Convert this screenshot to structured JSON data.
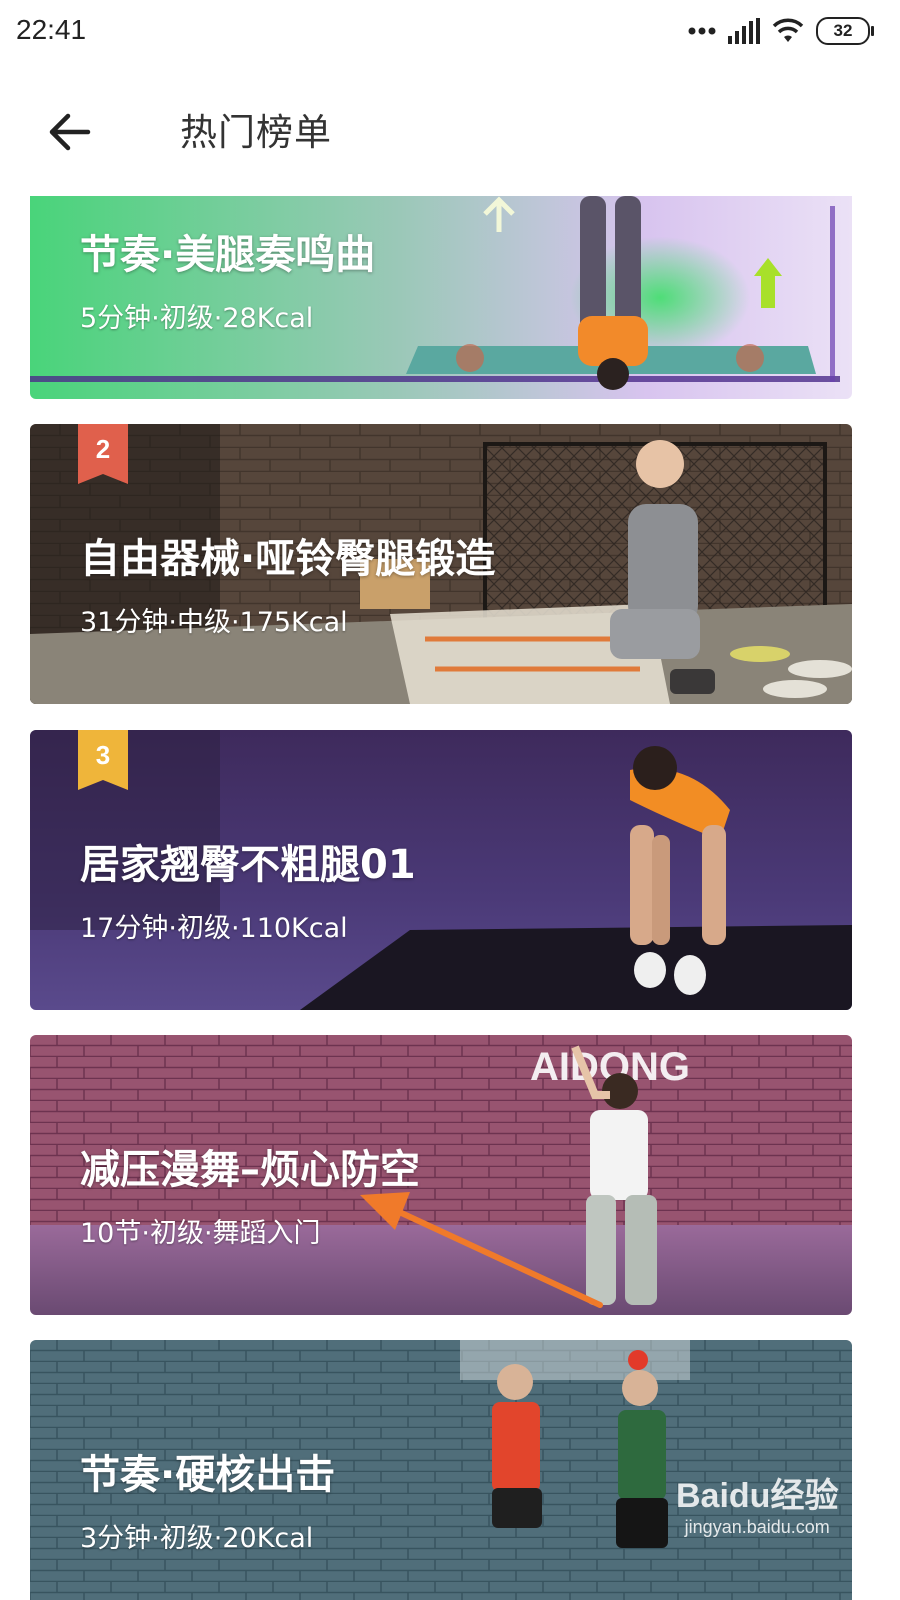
{
  "status_bar": {
    "time": "22:41",
    "battery": "32",
    "icons": [
      "dots-icon",
      "signal-icon",
      "wifi-icon",
      "battery-icon"
    ]
  },
  "header": {
    "back_icon": "arrow-left-icon",
    "title": "热门榜单"
  },
  "cards": [
    {
      "title": "节奏·美腿奏鸣曲",
      "subtitle": "5分钟·初级·28Kcal",
      "rank": ""
    },
    {
      "title": "自由器械·哑铃臀腿锻造",
      "subtitle": "31分钟·中级·175Kcal",
      "rank": "2",
      "badge_color": "#e0604c"
    },
    {
      "title": "居家翘臀不粗腿01",
      "subtitle": "17分钟·初级·110Kcal",
      "rank": "3",
      "badge_color": "#efb53a"
    },
    {
      "title": "减压漫舞–烦心防空",
      "subtitle": "10节·初级·舞蹈入门",
      "rank": "",
      "logo_text": "AIDONG"
    },
    {
      "title": "节奏·硬核出击",
      "subtitle": "3分钟·初级·20Kcal",
      "rank": ""
    }
  ],
  "watermark": {
    "brand": "Baidu经验",
    "url": "jingyan.baidu.com"
  },
  "annotation": {
    "type": "arrow",
    "color": "#f07a2a"
  }
}
